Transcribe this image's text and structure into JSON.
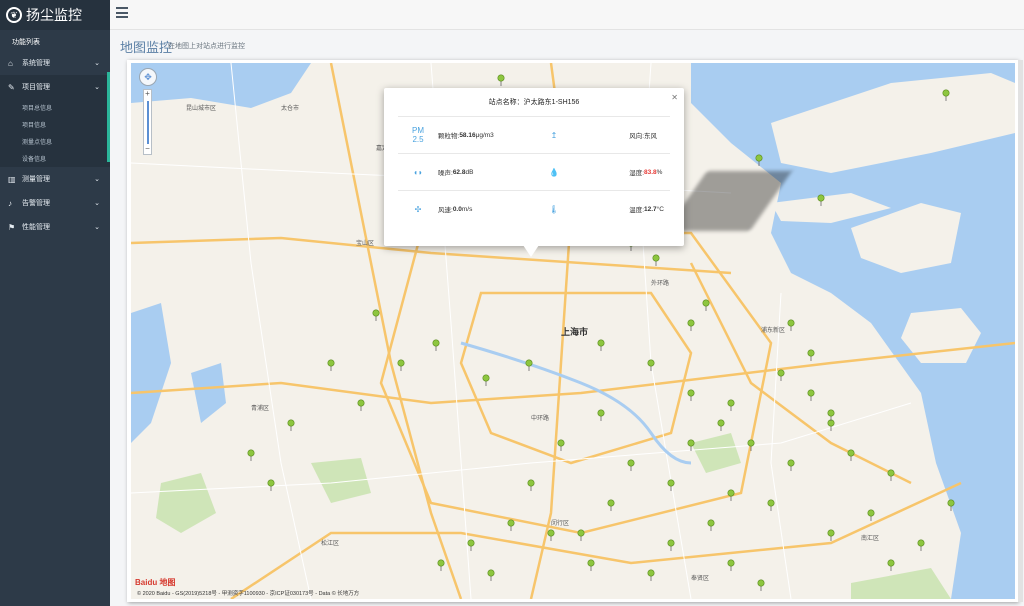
{
  "app": {
    "title": "扬尘监控"
  },
  "sidebar": {
    "section_label": "功能列表",
    "items": [
      {
        "label": "系统管理",
        "icon": "home-icon"
      },
      {
        "label": "项目管理",
        "icon": "edit-icon"
      },
      {
        "label": "测量管理",
        "icon": "chart-icon"
      },
      {
        "label": "告警管理",
        "icon": "bell-icon"
      },
      {
        "label": "性能管理",
        "icon": "flag-icon"
      }
    ],
    "subitems": [
      "项目总信息",
      "项目信息",
      "测量点信息",
      "设备信息"
    ]
  },
  "header": {
    "title": "地图监控",
    "subtitle": "在地图上对站点进行监控"
  },
  "map": {
    "city": "上海市",
    "places": [
      "昆山城市区",
      "太仓市",
      "嘉定区",
      "宝山区",
      "浦东新区",
      "青浦区",
      "松江区",
      "闵行区",
      "南汇区",
      "奉贤区",
      "外环路",
      "中环路"
    ],
    "baidu": "Baidu 地图",
    "copyright": "© 2020 Baidu - GS(2019)5218号 - 甲测资字1100930 - 京ICP证030173号 - Data © 长地万方",
    "colors": {
      "water": "#a9cdf1",
      "land": "#f4f1ea",
      "road": "#f7c56b",
      "green": "#cfe5b8",
      "marker": "#8dc63f"
    }
  },
  "popup": {
    "title": "站点名称：沪太路东1-SH156",
    "rows": [
      [
        {
          "icon": "pm25-icon",
          "label": "颗粒物:",
          "value": "58.16",
          "unit": "μg/m3"
        },
        {
          "icon": "wind-direction-icon",
          "label": "风向:",
          "value": "东风",
          "unit": ""
        }
      ],
      [
        {
          "icon": "noise-icon",
          "label": "噪声:",
          "value": "62.8",
          "unit": "dB"
        },
        {
          "icon": "humidity-icon",
          "label": "湿度:",
          "value": "83.8",
          "unit": "%"
        }
      ],
      [
        {
          "icon": "wind-speed-icon",
          "label": "风速:",
          "value": "0.0",
          "unit": "m/s"
        },
        {
          "icon": "thermometer-icon",
          "label": "温度:",
          "value": "12.7",
          "unit": "°C"
        }
      ]
    ]
  }
}
